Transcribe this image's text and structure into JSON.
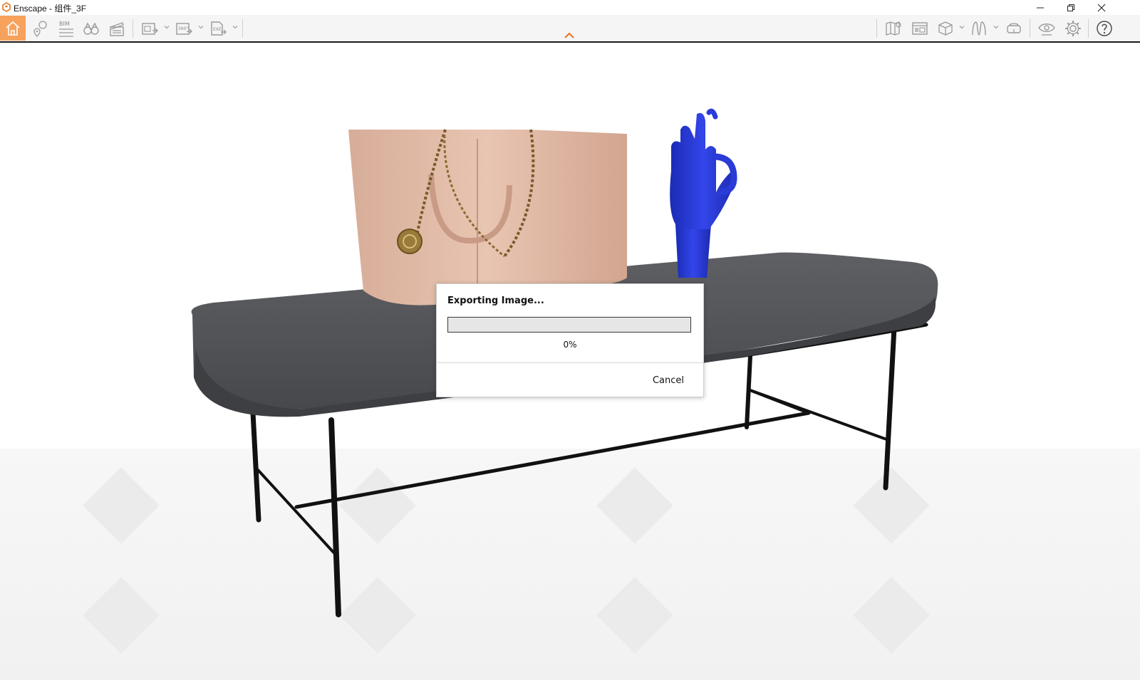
{
  "window": {
    "title": "Enscape - 组件_3F",
    "controls": [
      "minimize-icon",
      "restore-icon",
      "close-icon"
    ]
  },
  "toolbar": {
    "left_items": [
      {
        "name": "home-icon",
        "active": true
      },
      {
        "name": "location-pins-icon"
      },
      {
        "name": "bim-icon",
        "label": "BIM"
      },
      {
        "name": "binoculars-icon"
      },
      {
        "name": "video-editor-icon"
      },
      {
        "name": "screenshot-export-icon",
        "has_dropdown": true
      },
      {
        "name": "panorama-export-icon",
        "label": "360°",
        "has_dropdown": true
      },
      {
        "name": "exe-export-icon",
        "label": "EXE",
        "has_dropdown": true
      }
    ],
    "right_items": [
      {
        "name": "map-icon"
      },
      {
        "name": "asset-library-icon"
      },
      {
        "name": "view-cube-icon",
        "has_dropdown": true
      },
      {
        "name": "material-editor-icon",
        "has_dropdown": true
      },
      {
        "name": "vr-headset-icon"
      },
      {
        "name": "eye-icon"
      },
      {
        "name": "settings-gear-icon"
      },
      {
        "name": "help-icon"
      }
    ],
    "accent_color": "#f7a25c",
    "collapse_icon": "chevron-up-icon",
    "collapse_color": "#e8731c"
  },
  "dialog": {
    "title": "Exporting Image...",
    "progress_percent": 0,
    "progress_text": "0%",
    "cancel_label": "Cancel"
  }
}
